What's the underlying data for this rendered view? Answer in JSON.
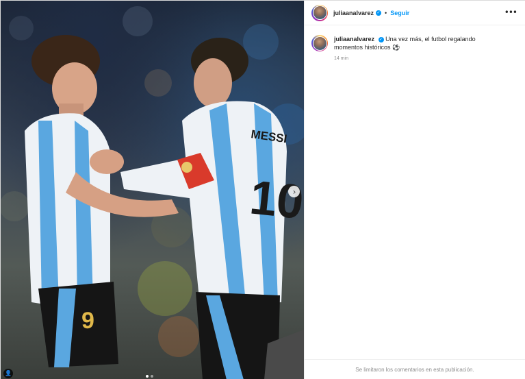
{
  "post": {
    "username": "juliaanalvarez",
    "separator": "•",
    "follow_label": "Seguir",
    "more_label": "•••",
    "caption": "Una vez más, el futbol regalando momentos históricos ⚽",
    "time_ago": "14 min",
    "comments_notice": "Se limitaron los comentarios en esta publicación."
  },
  "media": {
    "next_arrow": "›",
    "carousel_total": 2,
    "carousel_current": 1,
    "left_jersey_number": "9",
    "right_jersey_name": "MESSI",
    "right_jersey_number": "10"
  },
  "icons": {
    "verified": "✓",
    "user_tag": "👤"
  },
  "colors": {
    "link_blue": "#0095f6",
    "text_primary": "#262626",
    "text_secondary": "#8e8e8e",
    "jersey_blue": "#5aa7e0",
    "armband_red": "#d93a2b"
  }
}
